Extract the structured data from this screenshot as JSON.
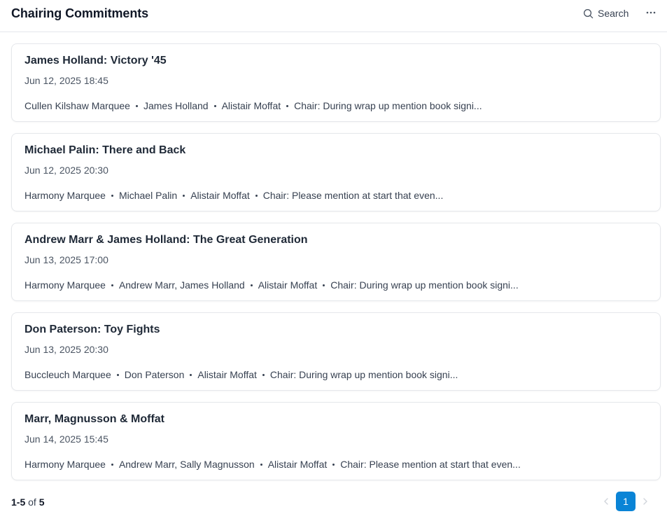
{
  "header": {
    "title": "Chairing Commitments",
    "search_label": "Search"
  },
  "items": [
    {
      "title": "James Holland: Victory '45",
      "date": "Jun 12, 2025 18:45",
      "venue": "Cullen Kilshaw Marquee",
      "speakers": "James Holland",
      "chair": "Alistair Moffat",
      "note": "Chair: During wrap up mention book signi..."
    },
    {
      "title": "Michael Palin: There and Back",
      "date": "Jun 12, 2025 20:30",
      "venue": "Harmony Marquee",
      "speakers": "Michael Palin",
      "chair": "Alistair Moffat",
      "note": "Chair: Please mention at start that even..."
    },
    {
      "title": "Andrew Marr & James Holland: The Great Generation",
      "date": "Jun 13, 2025 17:00",
      "venue": "Harmony Marquee",
      "speakers": "Andrew Marr, James Holland",
      "chair": "Alistair Moffat",
      "note": "Chair: During wrap up mention book signi..."
    },
    {
      "title": "Don Paterson: Toy Fights",
      "date": "Jun 13, 2025 20:30",
      "venue": "Buccleuch Marquee",
      "speakers": "Don Paterson",
      "chair": "Alistair Moffat",
      "note": "Chair: During wrap up mention book signi..."
    },
    {
      "title": "Marr, Magnusson & Moffat",
      "date": "Jun 14, 2025 15:45",
      "venue": "Harmony Marquee",
      "speakers": "Andrew Marr, Sally Magnusson",
      "chair": "Alistair Moffat",
      "note": "Chair: Please mention at start that even..."
    }
  ],
  "footer": {
    "range": "1-5",
    "of_label": "of",
    "total": "5",
    "current_page": "1"
  },
  "colors": {
    "accent": "#0a84d6",
    "border": "#e5e7eb"
  },
  "icons": {
    "search": "search-icon",
    "more": "more-horizontal-icon",
    "prev": "chevron-left-icon",
    "next": "chevron-right-icon"
  }
}
